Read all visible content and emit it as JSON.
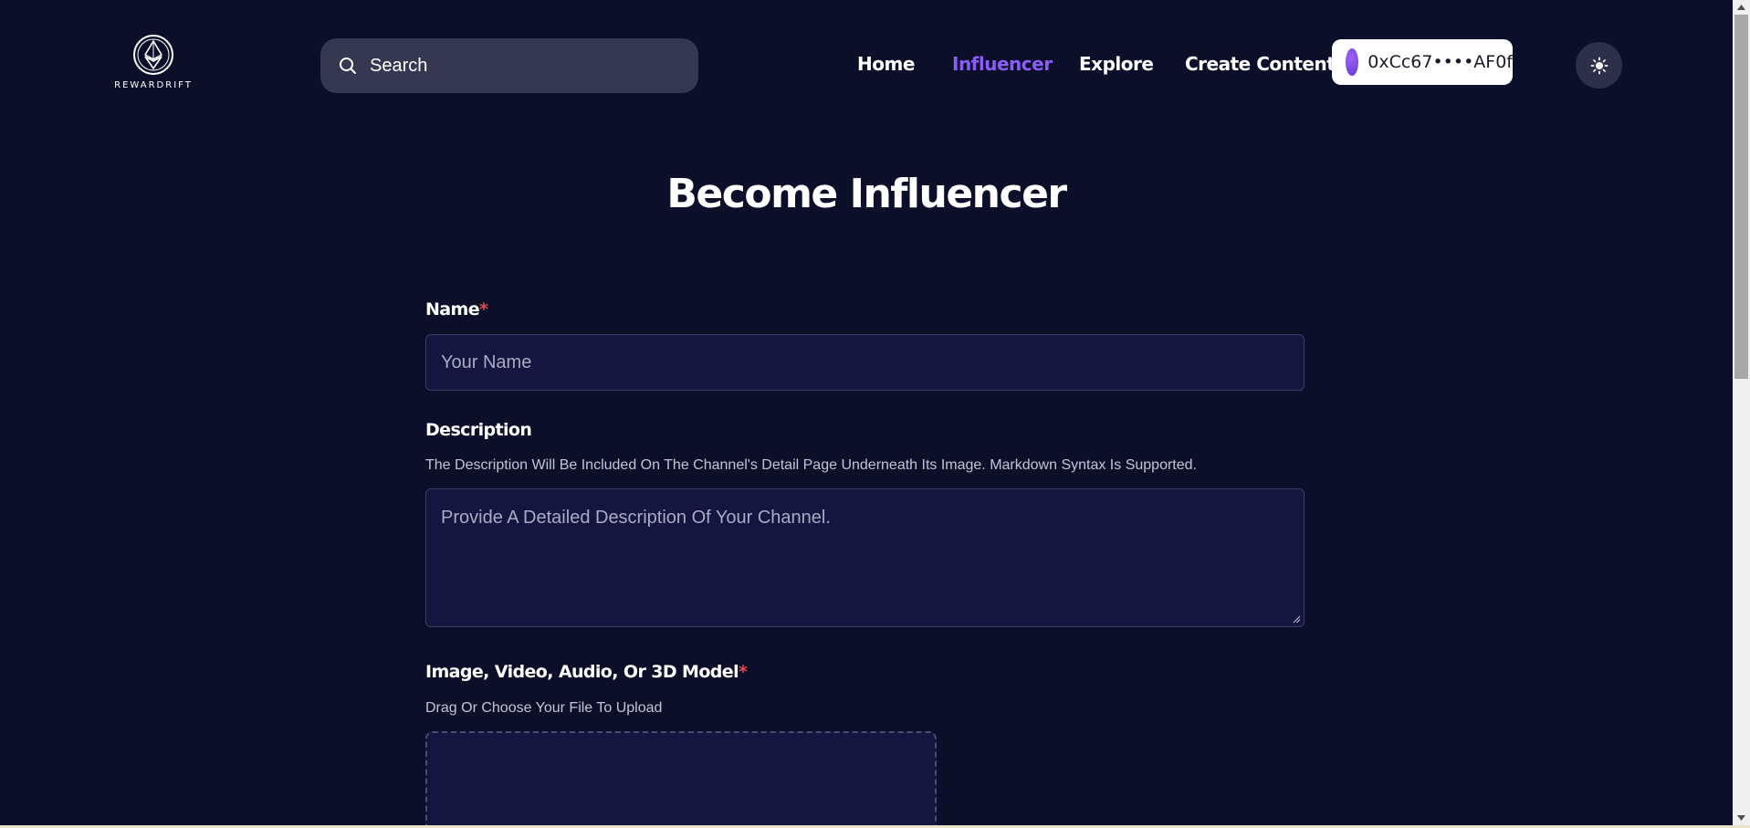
{
  "header": {
    "logo_text": "REWARDRIFT",
    "search_placeholder": "Search",
    "nav": {
      "home": "Home",
      "influencer": "Influencer",
      "explore": "Explore",
      "create_content": "Create Content"
    },
    "wallet_address": "0xCc67••••AF0f"
  },
  "colors": {
    "background": "#0c0f2a",
    "accent": "#8b5cf6",
    "input_bg": "#14163f",
    "required": "#e5484d"
  },
  "form": {
    "title": "Become Influencer",
    "name": {
      "label": "Name",
      "required_mark": "*",
      "placeholder": "Your Name"
    },
    "description": {
      "label": "Description",
      "helper": "The Description Will Be Included On The Channel's Detail Page Underneath Its Image. Markdown Syntax Is Supported.",
      "placeholder": "Provide A Detailed Description Of Your Channel."
    },
    "media": {
      "label": "Image, Video, Audio, Or 3D Model",
      "required_mark": "*",
      "helper": "Drag Or Choose Your File To Upload"
    }
  },
  "icons": {
    "logo": "ethereum-logo-icon",
    "search": "search-icon",
    "theme": "sun-icon"
  }
}
